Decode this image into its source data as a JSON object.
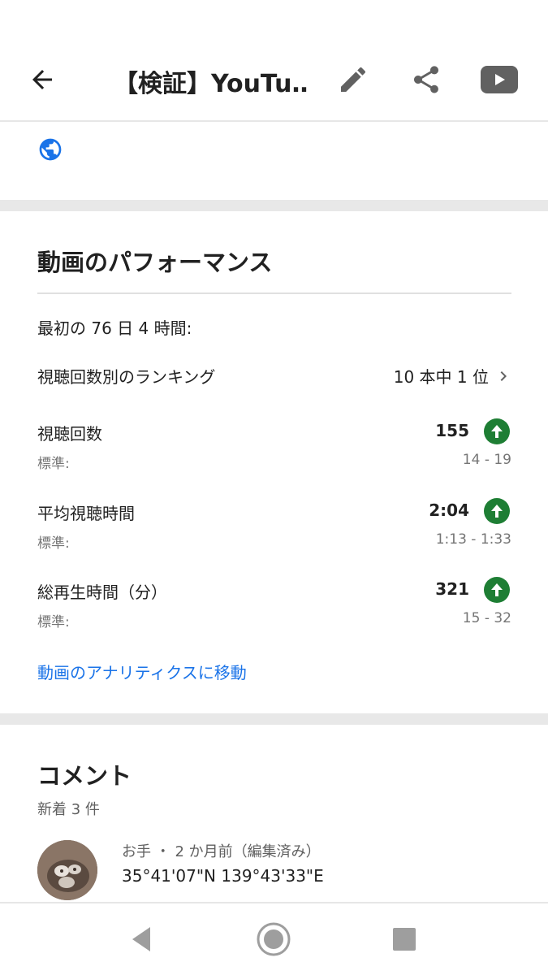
{
  "app_bar": {
    "title": "【検証】YouTu…",
    "icons": [
      "arrow-back-icon",
      "edit-pencil-icon",
      "share-icon",
      "youtube-icon"
    ]
  },
  "visibility": {
    "icon": "globe-icon",
    "color": "#1a73e8"
  },
  "performance": {
    "title": "動画のパフォーマンス",
    "period": "最初の 76 日 4 時間:",
    "ranking_label": "視聴回数別のランキング",
    "ranking_value": "10 本中 1 位",
    "metrics": [
      {
        "label": "視聴回数",
        "value": "155",
        "std_label": "標準:",
        "std_range": "14 - 19",
        "trend": "up"
      },
      {
        "label": "平均視聴時間",
        "value": "2:04",
        "std_label": "標準:",
        "std_range": "1:13 - 1:33",
        "trend": "up"
      },
      {
        "label": "総再生時間（分）",
        "value": "321",
        "std_label": "標準:",
        "std_range": "15 - 32",
        "trend": "up"
      }
    ],
    "analytics_link": "動画のアナリティクスに移動",
    "trend_color": "#1e7e34"
  },
  "comments": {
    "title": "コメント",
    "count": "新着 3 件",
    "items": [
      {
        "meta": "お手 ・ 2 か月前（編集済み）",
        "text": "35°41'07\"N 139°43'33\"E"
      }
    ]
  },
  "nav_bar": {
    "icons": [
      "nav-back-icon",
      "nav-home-icon",
      "nav-recent-icon"
    ]
  }
}
